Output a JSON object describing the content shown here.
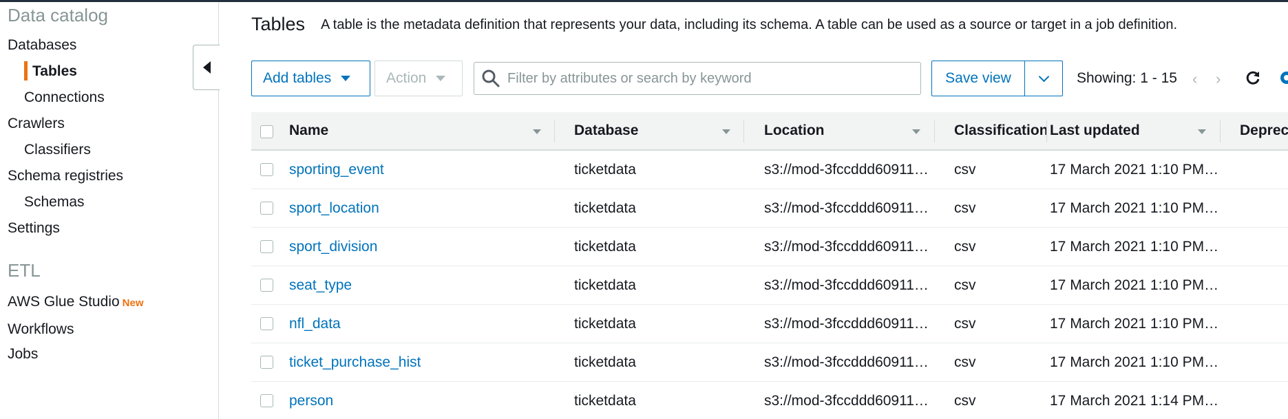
{
  "sidebar": {
    "heading": "Data catalog",
    "items": [
      {
        "label": "Databases"
      },
      {
        "label": "Tables"
      },
      {
        "label": "Connections"
      },
      {
        "label": "Crawlers"
      },
      {
        "label": "Classifiers"
      },
      {
        "label": "Schema registries"
      },
      {
        "label": "Schemas"
      },
      {
        "label": "Settings"
      }
    ],
    "etl_heading": "ETL",
    "etl_items": [
      {
        "label": "AWS Glue Studio",
        "badge": "New"
      },
      {
        "label": "Workflows"
      },
      {
        "label": "Jobs"
      }
    ]
  },
  "header": {
    "title": "Tables",
    "description": "A table is the metadata definition that represents your data, including its schema. A table can be used as a source or target in a job definition."
  },
  "toolbar": {
    "add_tables_label": "Add tables",
    "action_label": "Action",
    "search_placeholder": "Filter by attributes or search by keyword",
    "save_view_label": "Save view",
    "showing_text": "Showing: 1 - 15"
  },
  "table": {
    "columns": [
      "Name",
      "Database",
      "Location",
      "Classification",
      "Last updated",
      "Deprecated"
    ],
    "rows": [
      {
        "name": "sporting_event",
        "database": "ticketdata",
        "location": "s3://mod-3fccddd60911…",
        "classification": "csv",
        "last_updated": "17 March 2021 1:10 PM…"
      },
      {
        "name": "sport_location",
        "database": "ticketdata",
        "location": "s3://mod-3fccddd60911…",
        "classification": "csv",
        "last_updated": "17 March 2021 1:10 PM…"
      },
      {
        "name": "sport_division",
        "database": "ticketdata",
        "location": "s3://mod-3fccddd60911…",
        "classification": "csv",
        "last_updated": "17 March 2021 1:10 PM…"
      },
      {
        "name": "seat_type",
        "database": "ticketdata",
        "location": "s3://mod-3fccddd60911…",
        "classification": "csv",
        "last_updated": "17 March 2021 1:10 PM…"
      },
      {
        "name": "nfl_data",
        "database": "ticketdata",
        "location": "s3://mod-3fccddd60911…",
        "classification": "csv",
        "last_updated": "17 March 2021 1:10 PM…"
      },
      {
        "name": "ticket_purchase_hist",
        "database": "ticketdata",
        "location": "s3://mod-3fccddd60911…",
        "classification": "csv",
        "last_updated": "17 March 2021 1:10 PM…"
      },
      {
        "name": "person",
        "database": "ticketdata",
        "location": "s3://mod-3fccddd60911…",
        "classification": "csv",
        "last_updated": "17 March 2021 1:14 PM…"
      }
    ]
  },
  "colors": {
    "accent": "#0073bb",
    "active_marker": "#ec7211",
    "topbar": "#232f3e"
  }
}
